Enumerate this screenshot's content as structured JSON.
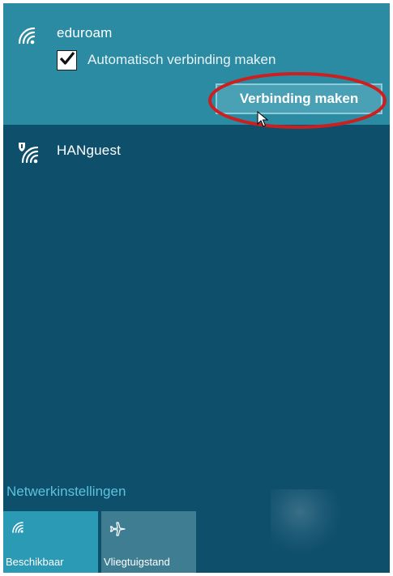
{
  "networks": {
    "selected": {
      "name": "eduroam",
      "auto_connect_label": "Automatisch verbinding maken",
      "auto_connect_checked": true,
      "connect_button_label": "Verbinding maken"
    },
    "other": [
      {
        "name": "HANguest",
        "secured": false
      }
    ]
  },
  "footer": {
    "settings_link": "Netwerkinstellingen",
    "tiles": [
      {
        "label": "Beschikbaar",
        "icon": "wifi-icon"
      },
      {
        "label": "Vliegtuigstand",
        "icon": "airplane-icon"
      }
    ]
  },
  "colors": {
    "background": "#0e4f6c",
    "selected_panel": "#2a8ba3",
    "button": "#4aa1b6",
    "link": "#5bc3dc",
    "tile_active": "#2a9ab5",
    "tile_inactive": "#3e7d92",
    "annotation": "#cc1f1f"
  }
}
